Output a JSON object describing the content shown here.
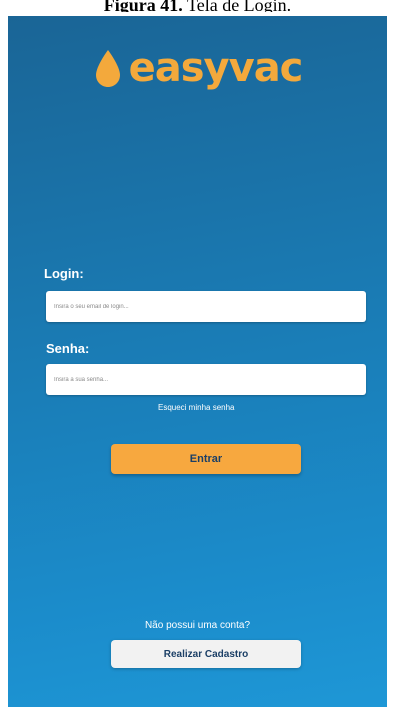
{
  "caption": {
    "prefix": "Figura 41.",
    "text": " Tela de Login."
  },
  "app": {
    "logo_text": "easyvac",
    "logo_icon": "drop-icon",
    "brand_color": "#f3a93c",
    "background_color": "#1b7cb6"
  },
  "login_form": {
    "login_label": "Login:",
    "login_placeholder": "Insira o seu email de login...",
    "password_label": "Senha:",
    "password_placeholder": "Insira a sua senha...",
    "forgot_password": "Esqueci minha senha",
    "submit_label": "Entrar"
  },
  "signup": {
    "prompt": "Não possui uma conta?",
    "button_label": "Realizar Cadastro"
  }
}
